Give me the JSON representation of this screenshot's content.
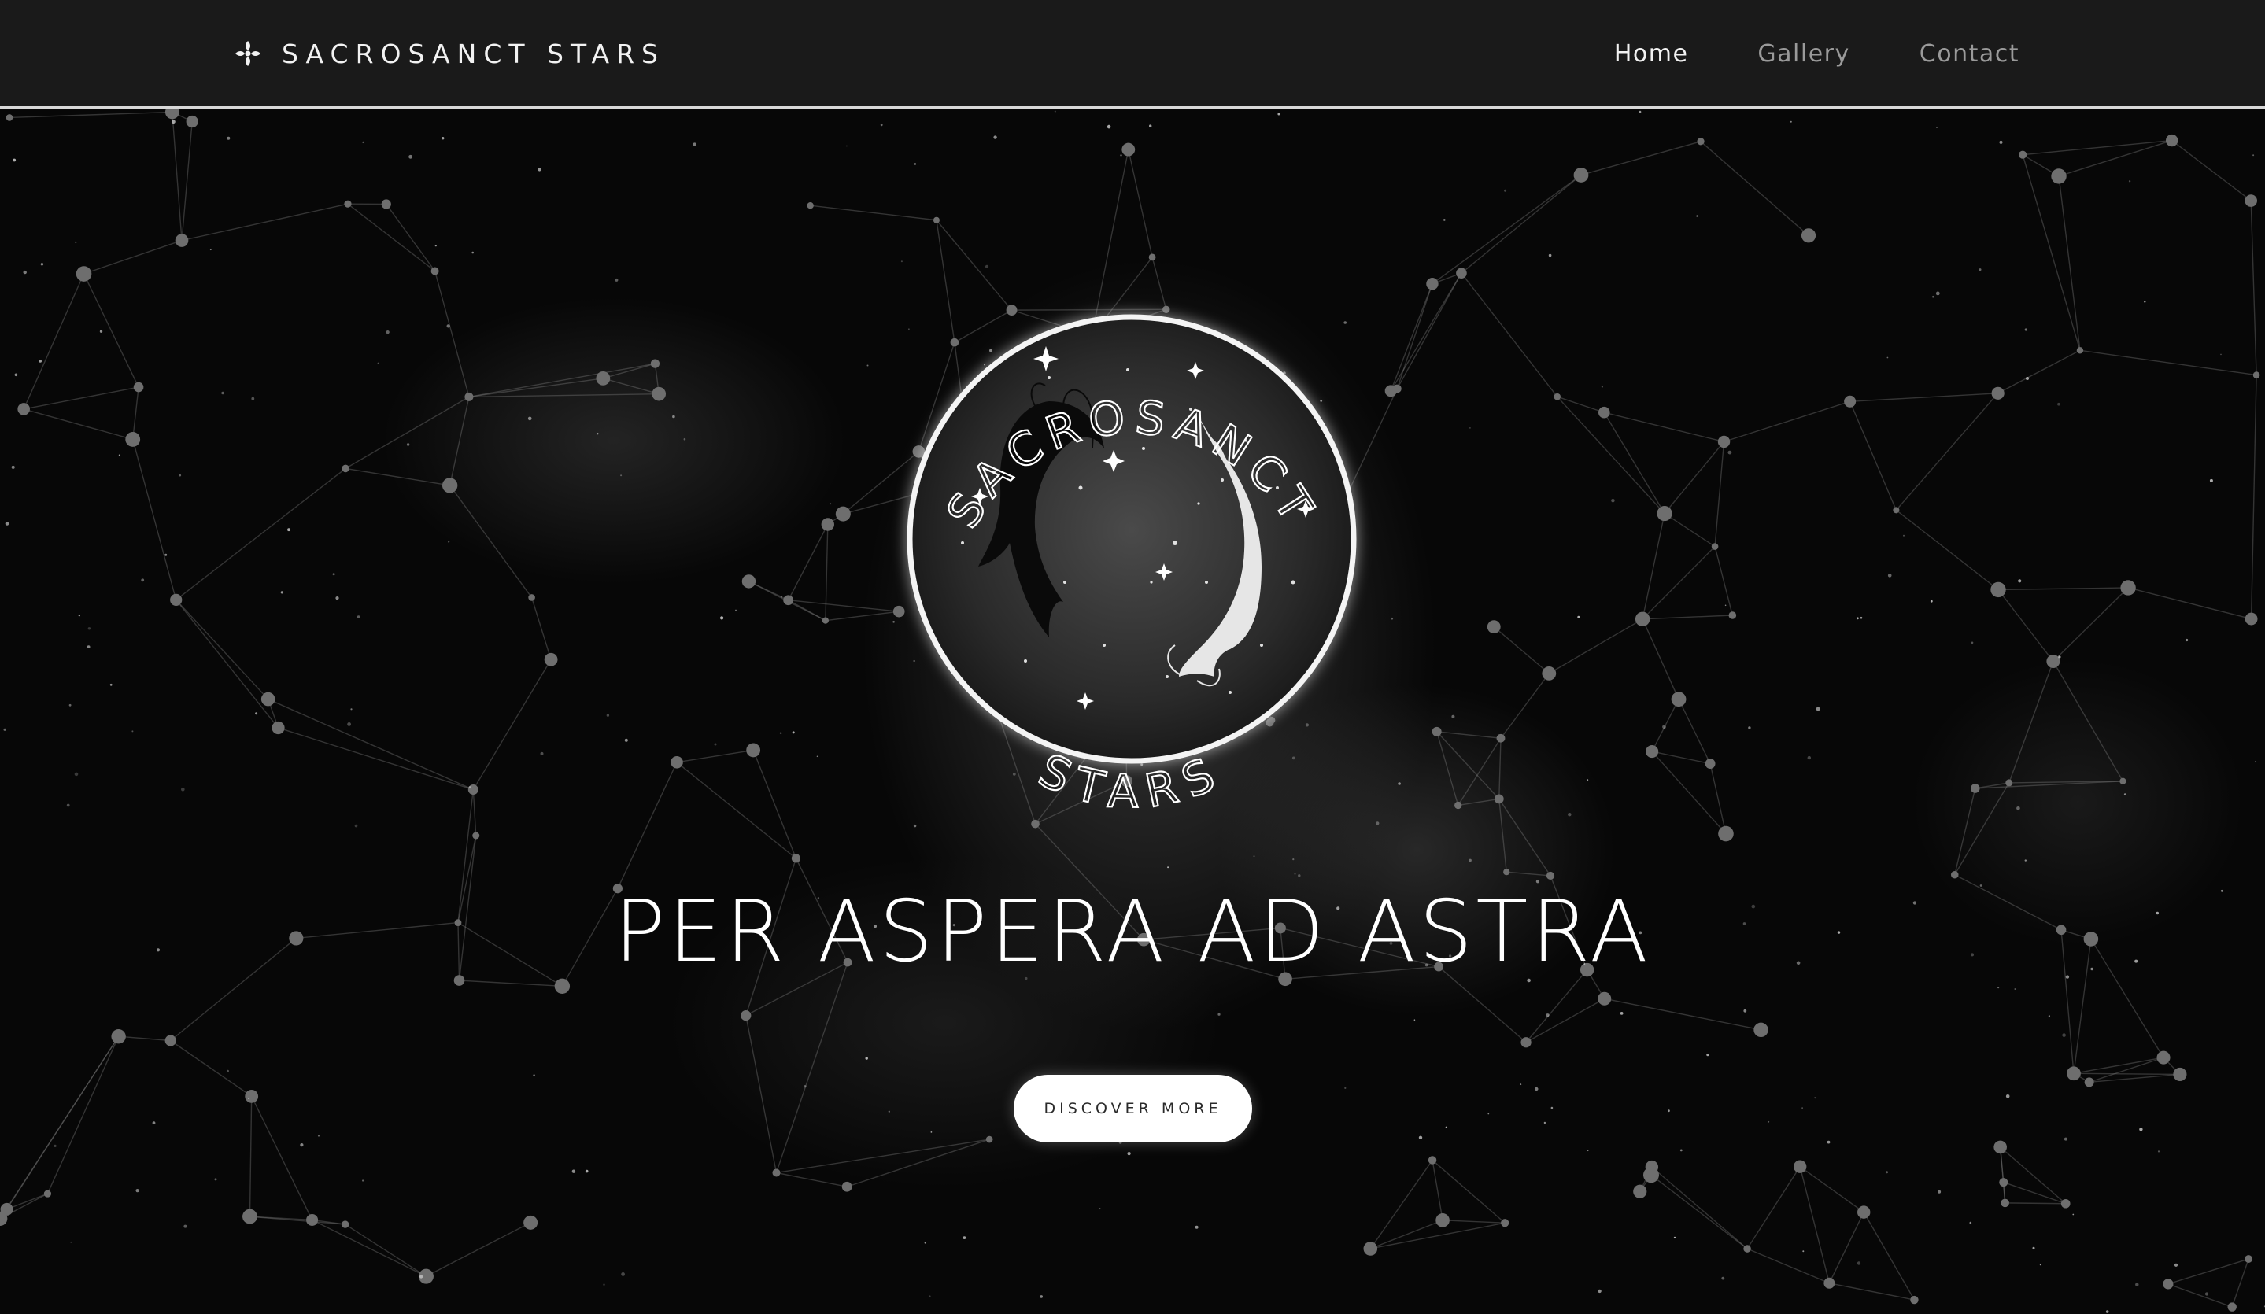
{
  "nav": {
    "brand": "SACROSANCT STARS",
    "brand_icon": "compass-star-icon",
    "links": [
      "Home",
      "Gallery",
      "Contact"
    ],
    "active": "Home"
  },
  "logo": {
    "arc_top": "SACROSANCT",
    "arc_bottom": "STARS",
    "emblem": "twin-koi-fish-icon"
  },
  "hero": {
    "headline": "PER ASPERA AD ASTRA",
    "cta_label": "DISCOVER MORE"
  },
  "colors": {
    "navbar": "#1a1a1a",
    "background": "#070707",
    "text": "#ffffff",
    "nav_muted": "#9a9a9a",
    "button": "#ffffff"
  }
}
